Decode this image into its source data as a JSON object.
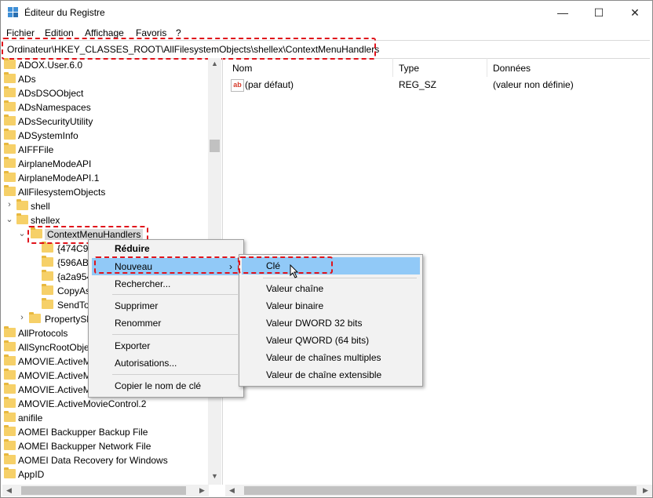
{
  "window": {
    "title": "Éditeur du Registre",
    "minimize": "—",
    "maximize": "☐",
    "close": "✕"
  },
  "menubar": [
    "Fichier",
    "Edition",
    "Affichage",
    "Favoris",
    "?"
  ],
  "address": "Ordinateur\\HKEY_CLASSES_ROOT\\AllFilesystemObjects\\shellex\\ContextMenuHandlers",
  "tree": [
    "ADOX.User.6.0",
    "ADs",
    "ADsDSOObject",
    "ADsNamespaces",
    "ADsSecurityUtility",
    "ADSystemInfo",
    "AIFFFile",
    "AirplaneModeAPI",
    "AirplaneModeAPI.1",
    "AllFilesystemObjects",
    "shell",
    "shellex",
    "ContextMenuHandlers",
    "{474C98",
    "{596AB0",
    "{a2a954",
    "CopyAs",
    "SendTo",
    "PropertySh",
    "AllProtocols",
    "AllSyncRootObje",
    "AMOVIE.ActiveM",
    "AMOVIE.ActiveM",
    "AMOVIE.ActiveM",
    "AMOVIE.ActiveMovieControl.2",
    "anifile",
    "AOMEI Backupper Backup File",
    "AOMEI Backupper Network File",
    "AOMEI Data Recovery for Windows",
    "AppID"
  ],
  "list": {
    "headers": {
      "name": "Nom",
      "type": "Type",
      "data": "Données"
    },
    "rows": [
      {
        "name": "(par défaut)",
        "type": "REG_SZ",
        "data": "(valeur non définie)",
        "icon": "ab"
      }
    ]
  },
  "context_menu": {
    "items": [
      "Réduire",
      "Nouveau",
      "Rechercher...",
      "Supprimer",
      "Renommer",
      "Exporter",
      "Autorisations...",
      "Copier le nom de clé"
    ],
    "submenu_arrow": "›"
  },
  "submenu": {
    "items": [
      "Clé",
      "Valeur chaîne",
      "Valeur binaire",
      "Valeur DWORD 32 bits",
      "Valeur QWORD (64 bits)",
      "Valeur de chaînes multiples",
      "Valeur de chaîne extensible"
    ]
  },
  "colors": {
    "highlight_border": "#e0131b",
    "menu_hover": "#91c9f7",
    "folder": "#f6d068"
  }
}
